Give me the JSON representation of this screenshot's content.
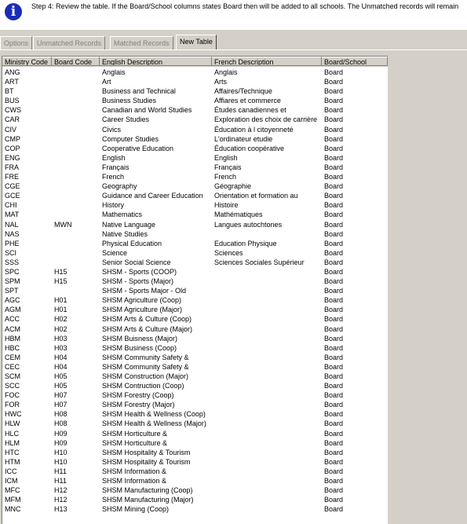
{
  "banner": {
    "icon": "info-icon",
    "text": "Step 4: Review the table. If the Board/School columns states Board then will be added to all schools.  The Unmatched records will remain"
  },
  "tabs": [
    {
      "label": "Options",
      "active": false
    },
    {
      "label": "Unmatched Records",
      "active": false
    },
    {
      "label": "Matched Records",
      "active": false
    },
    {
      "label": "New Table",
      "active": true
    }
  ],
  "table": {
    "columns": [
      "Ministry Code",
      "Board Code",
      "English Description",
      "French Description",
      "Board/School"
    ],
    "rows": [
      [
        "ANG",
        "",
        "Anglais",
        "Anglais",
        "Board"
      ],
      [
        "ART",
        "",
        "Art",
        "Arts",
        "Board"
      ],
      [
        "BT",
        "",
        "Business and Technical",
        "Affaires/Technique",
        "Board"
      ],
      [
        "BUS",
        "",
        "Business Studies",
        "Affiares et commerce",
        "Board"
      ],
      [
        "CWS",
        "",
        "Canadian and World Studies",
        "Études canadiennes et",
        "Board"
      ],
      [
        "CAR",
        "",
        "Career Studies",
        "Exploration des choix de carrière",
        "Board"
      ],
      [
        "CIV",
        "",
        "Civics",
        "Éducation à l citoyenneté",
        "Board"
      ],
      [
        "CMP",
        "",
        "Computer Studies",
        "L'ordinateur etudie",
        "Board"
      ],
      [
        "COP",
        "",
        "Cooperative Education",
        "Éducation coopérative",
        "Board"
      ],
      [
        "ENG",
        "",
        "English",
        "English",
        "Board"
      ],
      [
        "FRA",
        "",
        "Français",
        "Français",
        "Board"
      ],
      [
        "FRE",
        "",
        "French",
        "French",
        "Board"
      ],
      [
        "CGE",
        "",
        "Geography",
        "Géographie",
        "Board"
      ],
      [
        "GCE",
        "",
        "Guidance and Career Education",
        "Orientation et formation au",
        "Board"
      ],
      [
        "CHI",
        "",
        "History",
        "Histoire",
        "Board"
      ],
      [
        "MAT",
        "",
        "Mathematics",
        "Mathématiques",
        "Board"
      ],
      [
        "NAL",
        "MWN",
        "Native Language",
        "Langues autochtones",
        "Board"
      ],
      [
        "NAS",
        "",
        "Native Studies",
        "",
        "Board"
      ],
      [
        "PHE",
        "",
        "Physical Education",
        "Education Physique",
        "Board"
      ],
      [
        "SCI",
        "",
        "Science",
        "Sciences",
        "Board"
      ],
      [
        "SSS",
        "",
        "Senior Social Science",
        "Sciences Sociales Supérieur",
        "Board"
      ],
      [
        "SPC",
        "H15",
        "SHSM - Sports (COOP)",
        "",
        "Board"
      ],
      [
        "SPM",
        "H15",
        "SHSM - Sports (Major)",
        "",
        "Board"
      ],
      [
        "SPT",
        "",
        "SHSM - Sports Major - Old",
        "",
        "Board"
      ],
      [
        "AGC",
        "H01",
        "SHSM Agriculture (Coop)",
        "",
        "Board"
      ],
      [
        "AGM",
        "H01",
        "SHSM Agriculture (Major)",
        "",
        "Board"
      ],
      [
        "ACC",
        "H02",
        "SHSM Arts & Culture (Coop)",
        "",
        "Board"
      ],
      [
        "ACM",
        "H02",
        "SHSM Arts & Culture (Major)",
        "",
        "Board"
      ],
      [
        "HBM",
        "H03",
        "SHSM Buisness (Major)",
        "",
        "Board"
      ],
      [
        "HBC",
        "H03",
        "SHSM Business (Coop)",
        "",
        "Board"
      ],
      [
        "CEM",
        "H04",
        "SHSM Community Safety &",
        "",
        "Board"
      ],
      [
        "CEC",
        "H04",
        "SHSM Community Safety &",
        "",
        "Board"
      ],
      [
        "SCM",
        "H05",
        "SHSM Construction (Major)",
        "",
        "Board"
      ],
      [
        "SCC",
        "H05",
        "SHSM Contruction (Coop)",
        "",
        "Board"
      ],
      [
        "FOC",
        "H07",
        "SHSM Forestry (Coop)",
        "",
        "Board"
      ],
      [
        "FOR",
        "H07",
        "SHSM Forestry (Major)",
        "",
        "Board"
      ],
      [
        "HWC",
        "H08",
        "SHSM Health & Wellness (Coop)",
        "",
        "Board"
      ],
      [
        "HLW",
        "H08",
        "SHSM Health & Wellness (Major)",
        "",
        "Board"
      ],
      [
        "HLC",
        "H09",
        "SHSM Horticulture &",
        "",
        "Board"
      ],
      [
        "HLM",
        "H09",
        "SHSM Horticulture &",
        "",
        "Board"
      ],
      [
        "HTC",
        "H10",
        "SHSM Hospitality & Tourism",
        "",
        "Board"
      ],
      [
        "HTM",
        "H10",
        "SHSM Hospitality & Tourism",
        "",
        "Board"
      ],
      [
        "ICC",
        "H11",
        "SHSM Information &",
        "",
        "Board"
      ],
      [
        "ICM",
        "H11",
        "SHSM Information &",
        "",
        "Board"
      ],
      [
        "MFC",
        "H12",
        "SHSM Manufacturing (Coop)",
        "",
        "Board"
      ],
      [
        "MFM",
        "H12",
        "SHSM Manufacturing (Major)",
        "",
        "Board"
      ],
      [
        "MNC",
        "H13",
        "SHSM Mining (Coop)",
        "",
        "Board"
      ]
    ]
  }
}
